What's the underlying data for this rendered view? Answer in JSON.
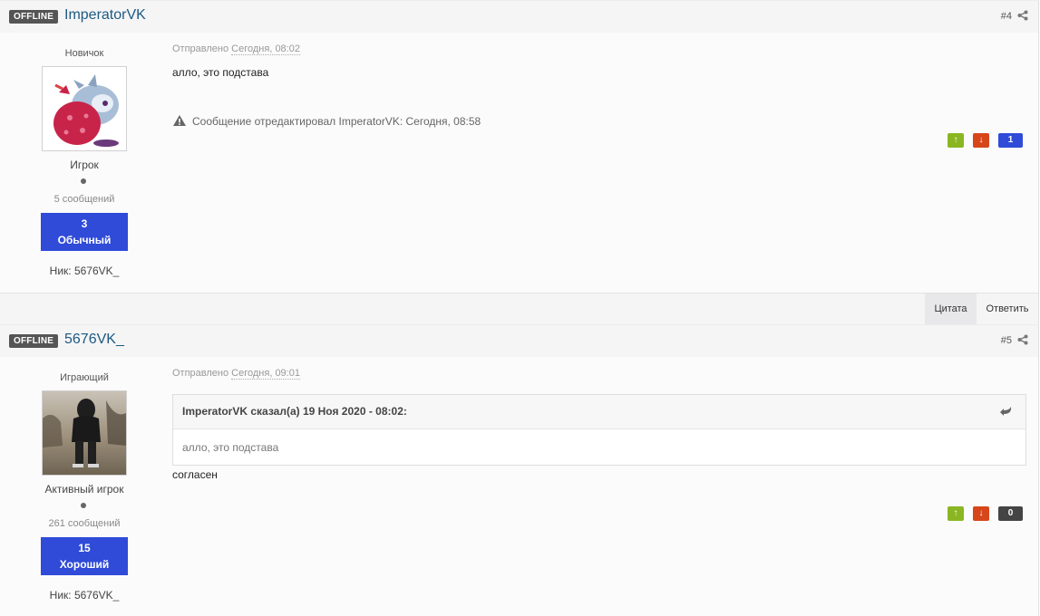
{
  "posts": [
    {
      "status": "OFFLINE",
      "author": "ImperatorVK",
      "number": "#4",
      "group": "Новичок",
      "rank": "Игрок",
      "post_count": "5 сообщений",
      "reputation": {
        "value": "3",
        "label": "Обычный",
        "color": "#2f4bd8"
      },
      "nick": "Ник: 5676VK_",
      "posted_label": "Отправлено",
      "posted_time": "Сегодня, 08:02",
      "text": "алло, это подстава",
      "edit_note": "Сообщение отредактировал ImperatorVK: Сегодня, 08:58",
      "votes": {
        "up_icon": "arrow-up-icon",
        "down_icon": "arrow-down-icon",
        "count": "1",
        "count_color": "#2f4bd8"
      },
      "avatar": "cartoon-creature-avatar"
    },
    {
      "status": "OFFLINE",
      "author": "5676VK_",
      "number": "#5",
      "group": "Играющий",
      "rank": "Активный игрок",
      "post_count": "261 сообщений",
      "reputation": {
        "value": "15",
        "label": "Хороший",
        "color": "#2f4bd8"
      },
      "nick": "Ник: 5676VK_",
      "posted_label": "Отправлено",
      "posted_time": "Сегодня, 09:01",
      "quote": {
        "header": "ImperatorVK сказал(а) 19 Ноя 2020 - 08:02:",
        "text": "алло, это подстава"
      },
      "text": "согласен",
      "votes": {
        "up_icon": "arrow-up-icon",
        "down_icon": "arrow-down-icon",
        "count": "0",
        "count_color": "#444444"
      },
      "avatar": "person-photo-avatar"
    }
  ],
  "actions": {
    "quote_label": "Цитата",
    "reply_label": "Ответить"
  },
  "colors": {
    "author_link": "#1d5a82",
    "vote_up": "#8ab622",
    "vote_down": "#d7461a",
    "header_bg": "#f5f5f6"
  }
}
